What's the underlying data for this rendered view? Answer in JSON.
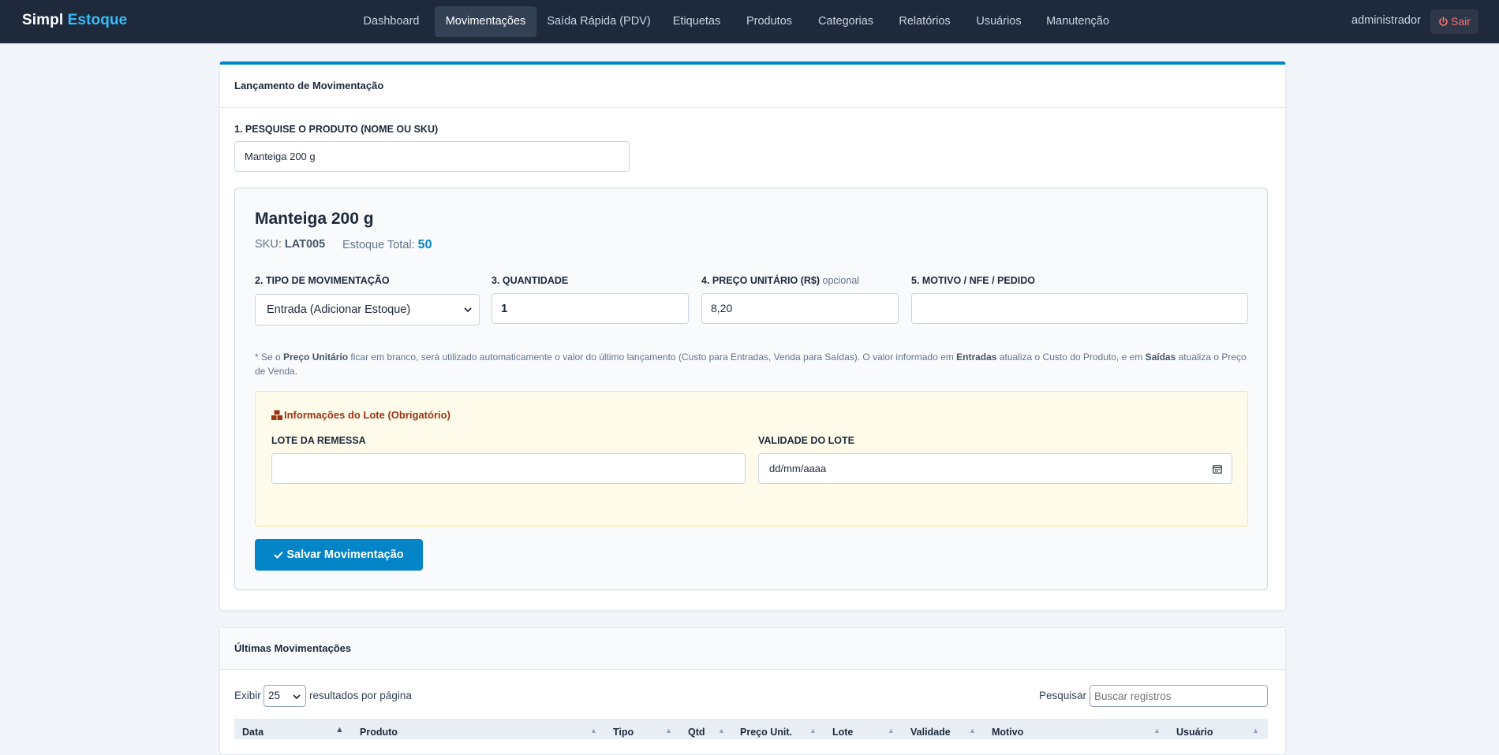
{
  "brand": {
    "part1": "Simpl",
    "part2": "Estoque"
  },
  "nav": {
    "items": [
      "Dashboard",
      "Movimentações",
      "Saída Rápida (PDV)",
      "Etiquetas",
      "Produtos",
      "Categorias",
      "Relatórios",
      "Usuários",
      "Manutenção"
    ],
    "active": "Movimentações",
    "user": "administrador",
    "logout": "Sair"
  },
  "launch": {
    "title": "Lançamento de Movimentação",
    "search_label": "1. PESQUISE O PRODUTO (NOME OU SKU)",
    "search_value": "Manteiga 200 g",
    "product": {
      "name": "Manteiga 200 g",
      "sku_label": "SKU:",
      "sku": "LAT005",
      "stock_label": "Estoque Total:",
      "stock": "50"
    },
    "fields": {
      "type_label": "2. TIPO DE MOVIMENTAÇÃO",
      "type_value": "Entrada (Adicionar Estoque)",
      "qty_label": "3. QUANTIDADE",
      "qty_value": "1",
      "price_label": "4. PREÇO UNITÁRIO (R$)",
      "price_optional": "opcional",
      "price_value": "8,20",
      "reason_label": "5. MOTIVO / NFE / PEDIDO",
      "reason_value": ""
    },
    "note": {
      "p1": "* Se o ",
      "b1": "Preço Unitário",
      "p2": " ficar em branco, será utilizado automaticamente o valor do último lançamento (Custo para Entradas, Venda para Saídas). O valor informado em ",
      "b2": "Entradas",
      "p3": " atualiza o Custo do Produto, e em ",
      "b3": "Saídas",
      "p4": " atualiza o Preço de Venda."
    },
    "lote": {
      "title": "Informações do Lote (Obrigatório)",
      "batch_label": "LOTE DA REMESSA",
      "batch_value": "",
      "validity_label": "VALIDADE DO LOTE",
      "validity_placeholder": "dd/mm/aaaa"
    },
    "save_button": "Salvar Movimentação"
  },
  "recent": {
    "title": "Últimas Movimentações",
    "show_label": "Exibir",
    "page_size": "25",
    "per_page_label": "resultados por página",
    "search_label": "Pesquisar",
    "search_placeholder": "Buscar registros",
    "columns": [
      "Data",
      "Produto",
      "Tipo",
      "Qtd",
      "Preço Unit.",
      "Lote",
      "Validade",
      "Motivo",
      "Usuário"
    ]
  },
  "colors": {
    "accent": "#0284c7",
    "navbar": "#1e293b",
    "brand_accent": "#38bdf8",
    "stock": "#0284c7",
    "lote_title": "#9a3412"
  }
}
